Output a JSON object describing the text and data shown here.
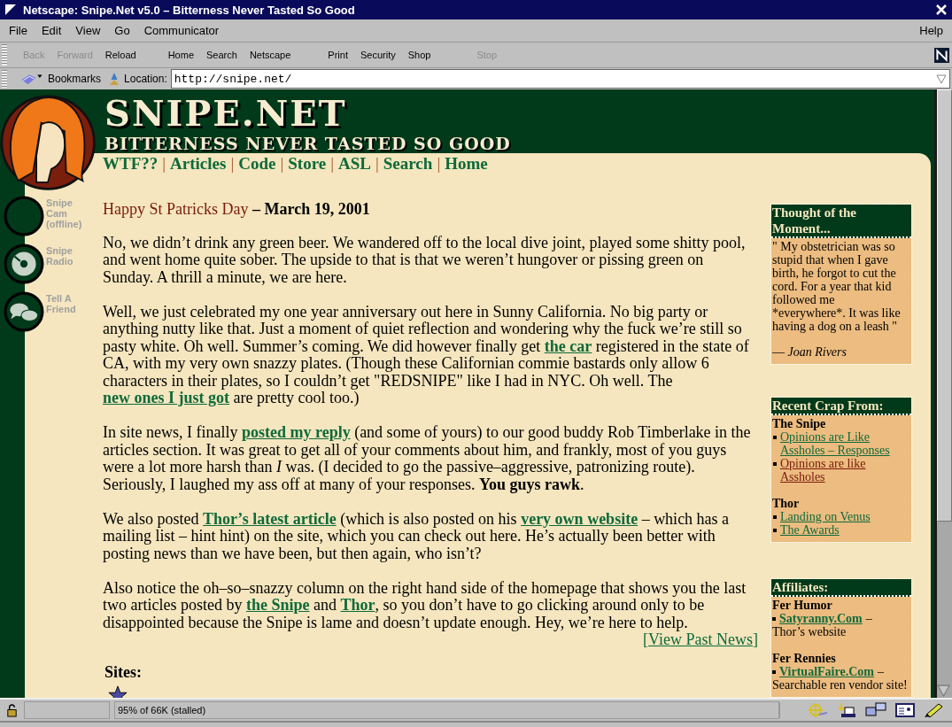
{
  "window": {
    "title": "Netscape: Snipe.Net v5.0 – Bitterness Never Tasted So Good"
  },
  "menu": [
    "File",
    "Edit",
    "View",
    "Go",
    "Communicator"
  ],
  "help_menu": "Help",
  "toolbar": [
    {
      "label": "Back",
      "disabled": true
    },
    {
      "label": "Forward",
      "disabled": true
    },
    {
      "label": "Reload",
      "disabled": false
    },
    {
      "label": "Home",
      "disabled": false
    },
    {
      "label": "Search",
      "disabled": false
    },
    {
      "label": "Netscape",
      "disabled": false
    },
    {
      "label": "Print",
      "disabled": false
    },
    {
      "label": "Security",
      "disabled": false
    },
    {
      "label": "Shop",
      "disabled": false
    },
    {
      "label": "Stop",
      "disabled": true
    }
  ],
  "location_bar": {
    "bookmarks": "Bookmarks",
    "label": "Location:",
    "url": "http://snipe.net/"
  },
  "site": {
    "logo": "SNIPE.NET",
    "tagline": "BITTERNESS NEVER TASTED SO GOOD",
    "separator": "|",
    "nav": [
      "WTF??",
      "Articles",
      "Code",
      "Store",
      "ASL",
      "Search",
      "Home"
    ],
    "side_links": [
      {
        "kind": "cam",
        "lines": [
          "Snipe",
          "Cam",
          "(offline)"
        ]
      },
      {
        "kind": "radio",
        "lines": [
          "Snipe",
          "Radio"
        ]
      },
      {
        "kind": "friend",
        "lines": [
          "Tell A",
          "Friend"
        ]
      }
    ]
  },
  "post": {
    "title": "Happy St Patricks Day",
    "date": "– March 19, 2001",
    "paragraphs": [
      [
        {
          "text": "No, we didn’t drink any green beer. We wandered off to the local dive joint, played some shitty pool, and went home quite sober. The upside to that is that we weren’t hungover or pissing green on Sunday. A thrill a minute, we are here."
        }
      ],
      [
        {
          "text": "Well, we just celebrated my one year anniversary out here in Sunny California. No big party or anything nutty like that. Just a moment of quiet reflection and wondering why the fuck we’re still so pasty white. Oh well. Summer’s coming. We did however finally get "
        },
        {
          "link": "the car"
        },
        {
          "text": " registered in the state of CA, with my very own snazzy plates. (Though these Californian commie bastards only allow 6 characters in their plates, so I couldn’t get \"REDSNIPE\" like I had in NYC. Oh well. The "
        },
        {
          "link": "new ones I just got"
        },
        {
          "text": " are pretty cool too.)"
        }
      ],
      [
        {
          "text": "In site news, I finally "
        },
        {
          "link": "posted my reply"
        },
        {
          "text": " (and some of yours) to our good buddy Rob Timberlake in the articles section. It was great to get all of your comments about him, and frankly, most of you guys were a lot more harsh than *I* was. (I decided to go the passive–aggressive, patronizing route). Seriously, I laughed my ass off at many of your responses. **You guys rawk**."
        }
      ],
      [
        {
          "text": "We also posted "
        },
        {
          "link": "Thor’s latest article"
        },
        {
          "text": " (which is also posted on his "
        },
        {
          "link": "very own website"
        },
        {
          "text": " – which has a mailing list – hint hint) on the site, which you can check out here. He’s actually been better with posting news than we have been, but then again, who isn’t?"
        }
      ],
      [
        {
          "text": "Also notice the oh–so–snazzy column on the right hand side of the homepage that shows you the last two articles posted by "
        },
        {
          "link": "the Snipe"
        },
        {
          "text": " and "
        },
        {
          "link": "Thor"
        },
        {
          "text": ", so you don’t have to go clicking around only to be disappointed because the Snipe is lame and doesn’t update enough. Hey, we’re here to help."
        }
      ]
    ],
    "past_news": "[View Past News]",
    "sites_heading": "Sites:"
  },
  "sidebar": {
    "thought": {
      "title": "Thought of the Moment...",
      "quote": "\" My obstetrician was so stupid that when I gave birth, he forgot to cut the cord. For a year that kid followed me *everywhere*. It was like having a dog on a leash \"",
      "author": "–– Joan Rivers"
    },
    "recent": {
      "title": "Recent Crap From:",
      "groups": [
        {
          "name": "The Snipe",
          "items": [
            {
              "label": "Opinions are Like Assholes – Responses",
              "visited": false
            },
            {
              "label": "Opinions are like Assholes",
              "visited": true
            }
          ]
        },
        {
          "name": "Thor",
          "items": [
            {
              "label": "Landing on Venus",
              "visited": false
            },
            {
              "label": "The Awards",
              "visited": false
            }
          ]
        }
      ]
    },
    "affiliates": {
      "title": "Affiliates:",
      "separator": "–",
      "groups": [
        {
          "name": "Fer Humor",
          "items": [
            {
              "label": "Satyranny.Com",
              "desc": "Thor’s website"
            }
          ]
        },
        {
          "name": "Fer Rennies",
          "items": [
            {
              "label": "VirtualFaire.Com",
              "desc": "Searchable ren vendor site!"
            }
          ]
        }
      ]
    }
  },
  "status_bar": {
    "text": "95% of 66K (stalled)"
  }
}
